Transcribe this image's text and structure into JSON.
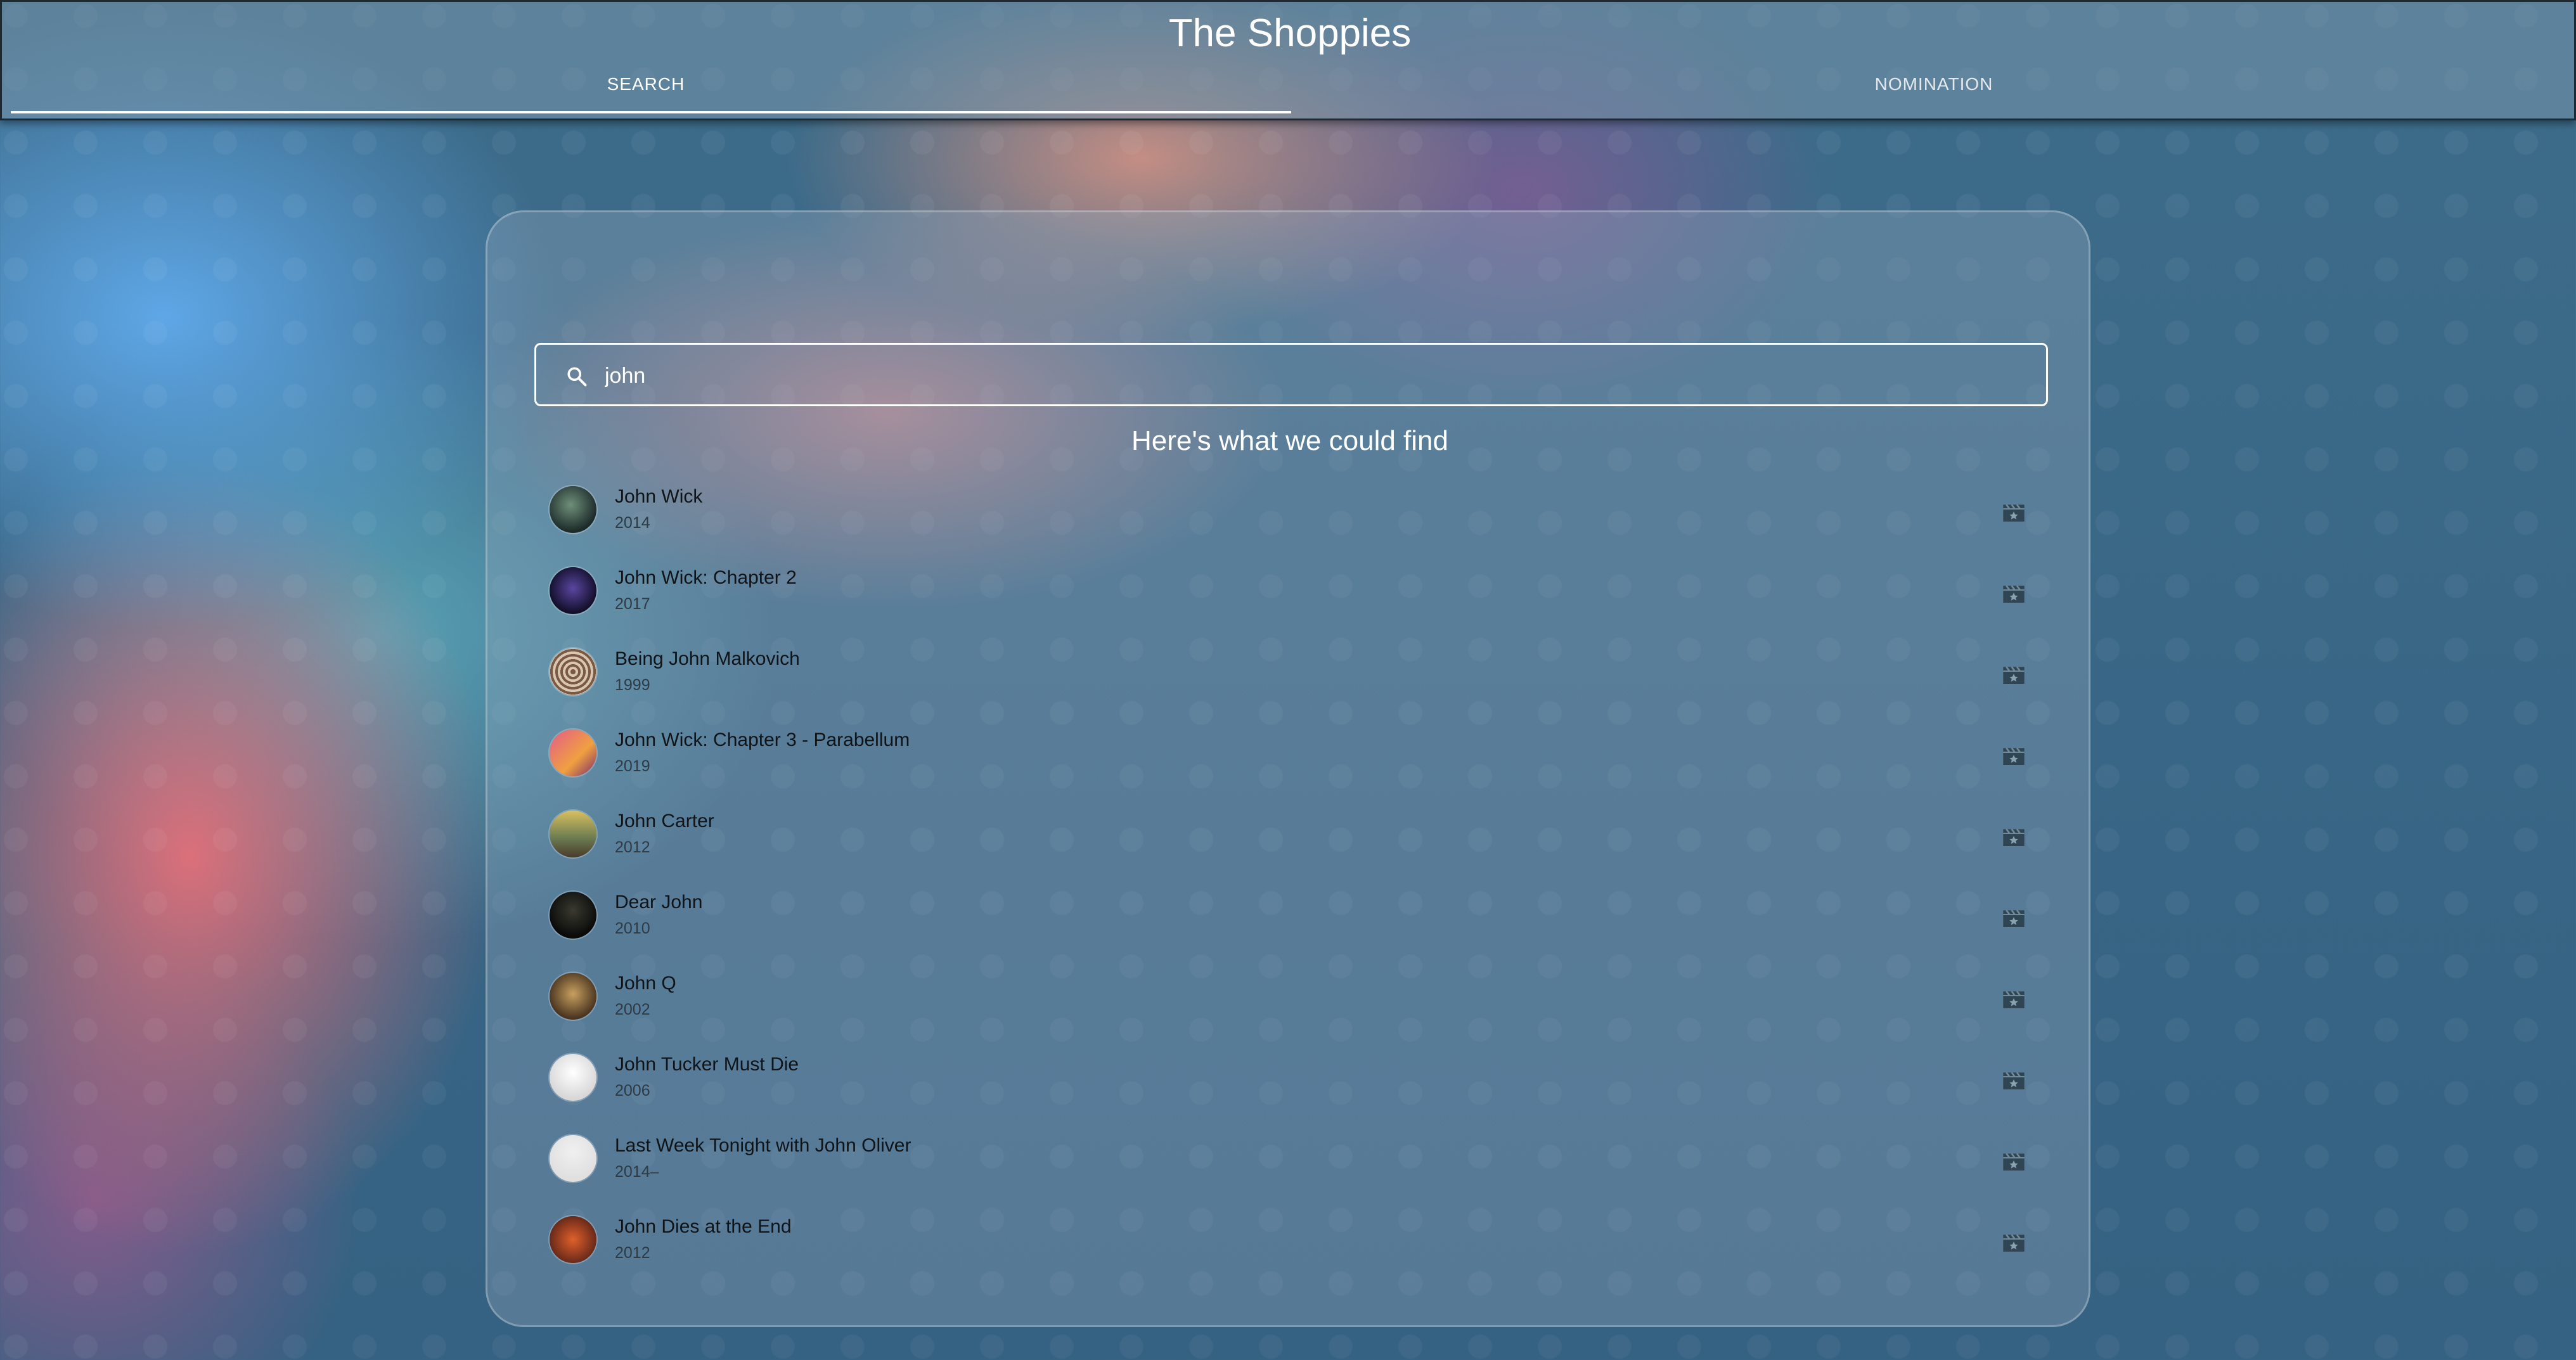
{
  "header": {
    "title": "The Shoppies",
    "tabs": [
      {
        "label": "SEARCH",
        "active": true
      },
      {
        "label": "NOMINATION",
        "active": false
      }
    ]
  },
  "search": {
    "value": "john",
    "icon": "search-icon"
  },
  "results": {
    "heading": "Here's what we could find",
    "items": [
      {
        "title": "John Wick",
        "year": "2014",
        "icon": "movie-icon"
      },
      {
        "title": "John Wick: Chapter 2",
        "year": "2017",
        "icon": "movie-icon"
      },
      {
        "title": "Being John Malkovich",
        "year": "1999",
        "icon": "movie-icon"
      },
      {
        "title": "John Wick: Chapter 3 - Parabellum",
        "year": "2019",
        "icon": "movie-icon"
      },
      {
        "title": "John Carter",
        "year": "2012",
        "icon": "movie-icon"
      },
      {
        "title": "Dear John",
        "year": "2010",
        "icon": "movie-icon"
      },
      {
        "title": "John Q",
        "year": "2002",
        "icon": "movie-icon"
      },
      {
        "title": "John Tucker Must Die",
        "year": "2006",
        "icon": "movie-icon"
      },
      {
        "title": "Last Week Tonight with John Oliver",
        "year": "2014–",
        "icon": "movie-icon"
      },
      {
        "title": "John Dies at the End",
        "year": "2012",
        "icon": "movie-icon"
      }
    ]
  },
  "colors": {
    "accent": "#ffffff",
    "background": "#356182"
  }
}
